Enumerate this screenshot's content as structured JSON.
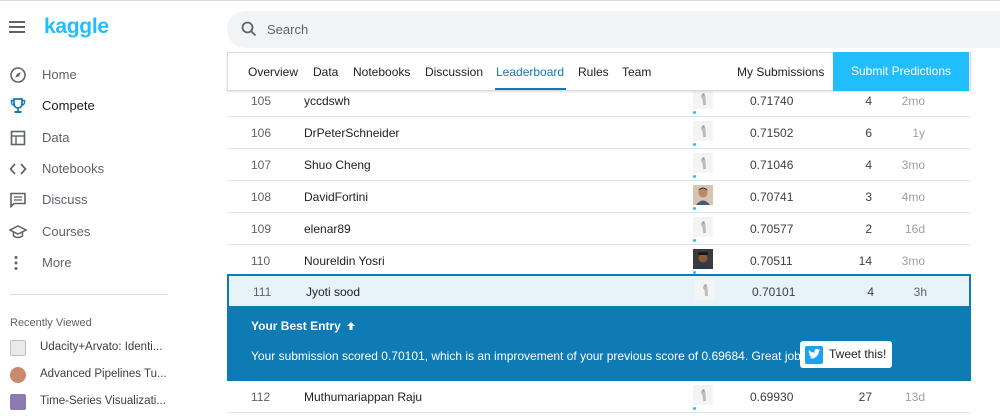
{
  "header": {
    "logo": "kaggle",
    "search_placeholder": "Search"
  },
  "sidebar": {
    "items": [
      {
        "label": "Home",
        "icon": "compass-icon"
      },
      {
        "label": "Compete",
        "icon": "trophy-icon"
      },
      {
        "label": "Data",
        "icon": "table-icon"
      },
      {
        "label": "Notebooks",
        "icon": "code-icon"
      },
      {
        "label": "Discuss",
        "icon": "comment-icon"
      },
      {
        "label": "Courses",
        "icon": "school-icon"
      },
      {
        "label": "More",
        "icon": "more-vert-icon"
      }
    ],
    "recently_viewed_title": "Recently Viewed",
    "recently_viewed": [
      "Udacity+Arvato: Identi...",
      "Advanced Pipelines Tu...",
      "Time-Series Visualizati..."
    ]
  },
  "tabs": [
    "Overview",
    "Data",
    "Notebooks",
    "Discussion",
    "Leaderboard",
    "Rules",
    "Team"
  ],
  "active_tab": "Leaderboard",
  "my_submissions": "My Submissions",
  "submit_button": "Submit Predictions",
  "leaderboard": [
    {
      "rank": "105",
      "team": "yccdswh",
      "score": "0.71740",
      "entries": "4",
      "last": "2mo"
    },
    {
      "rank": "106",
      "team": "DrPeterSchneider",
      "score": "0.71502",
      "entries": "6",
      "last": "1y"
    },
    {
      "rank": "107",
      "team": "Shuo Cheng",
      "score": "0.71046",
      "entries": "4",
      "last": "3mo"
    },
    {
      "rank": "108",
      "team": "DavidFortini",
      "score": "0.70741",
      "entries": "3",
      "last": "4mo"
    },
    {
      "rank": "109",
      "team": "elenar89",
      "score": "0.70577",
      "entries": "2",
      "last": "16d"
    },
    {
      "rank": "110",
      "team": "Noureldin Yosri",
      "score": "0.70511",
      "entries": "14",
      "last": "3mo"
    },
    {
      "rank": "111",
      "team": "Jyoti sood",
      "score": "0.70101",
      "entries": "4",
      "last": "3h"
    },
    {
      "rank": "112",
      "team": "Muthumariappan Raju",
      "score": "0.69930",
      "entries": "27",
      "last": "13d"
    }
  ],
  "best_entry": {
    "title": "Your Best Entry",
    "message": "Your submission scored 0.70101, which is an improvement of your previous score of 0.69684. Great job!",
    "tweet_label": "Tweet this!"
  },
  "colors": {
    "brand": "#20beff",
    "accent": "#0f7bb5"
  }
}
